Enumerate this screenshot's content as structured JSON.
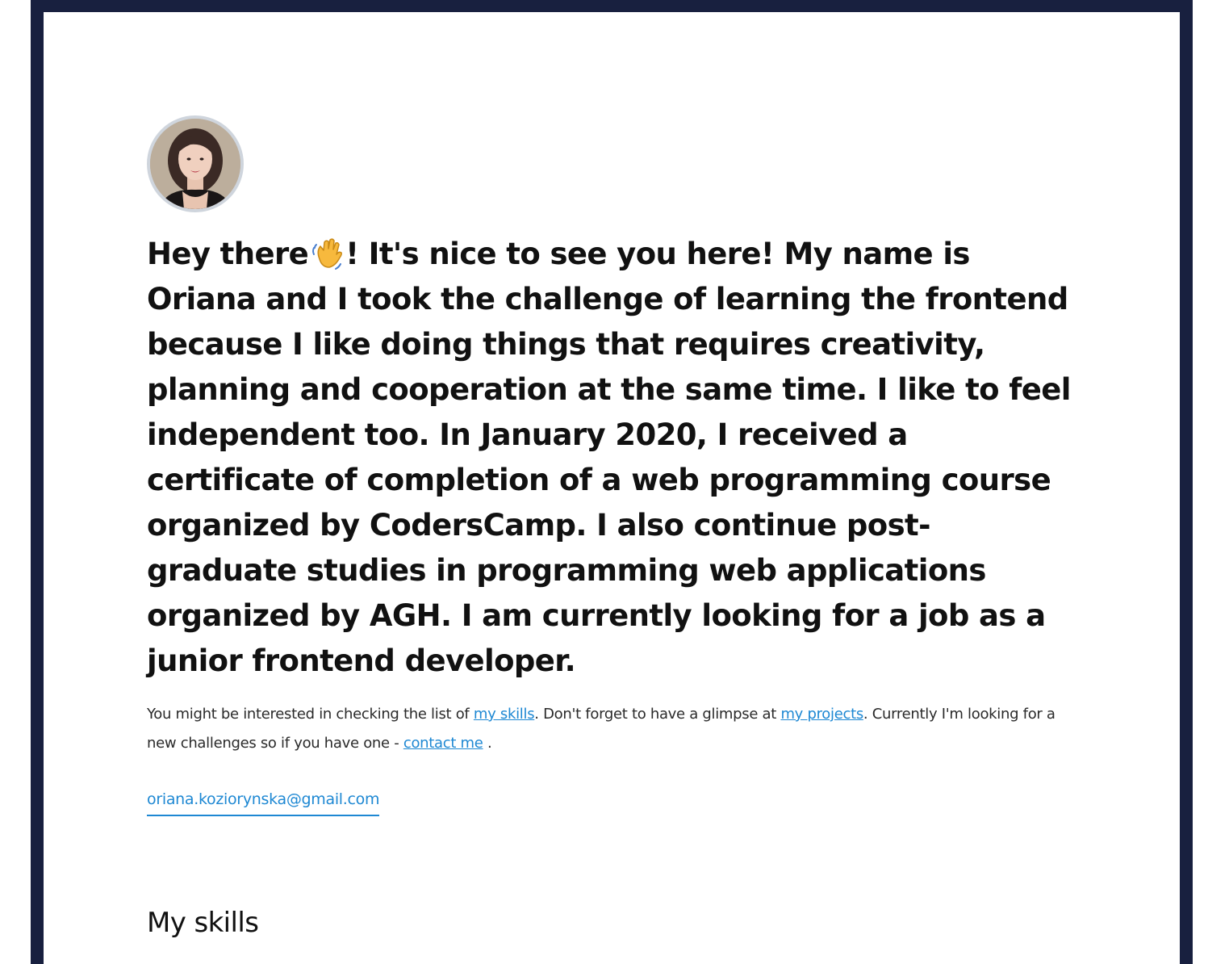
{
  "intro": {
    "before_emoji": "Hey there",
    "after_emoji": "! It's nice to see you here! My name is Oriana and I took the challenge of learning the frontend because I like doing things that requires creativity, planning and cooperation at the same time. I like to feel independent too. In January 2020, I received a certificate of completion of a web programming course organized by CodersCamp. I also continue post-graduate studies in programming web applications organized by AGH. I am currently looking for a job as a junior frontend developer.",
    "emoji": "waving-hand-icon"
  },
  "blurb": {
    "part1": "You might be interested in checking the list of ",
    "link_skills": "my skills",
    "part2": ". Don't forget to have a glimpse at ",
    "link_projects": "my projects",
    "part3": ". Currently I'm looking for a new challenges so if you have one - ",
    "link_contact": "contact me",
    "part4": " ."
  },
  "email": "oriana.koziorynska@gmail.com",
  "skills_heading": "My skills",
  "colors": {
    "frame": "#18203f",
    "link": "#1e88d3",
    "avatar_ring": "#cfd5dd"
  }
}
